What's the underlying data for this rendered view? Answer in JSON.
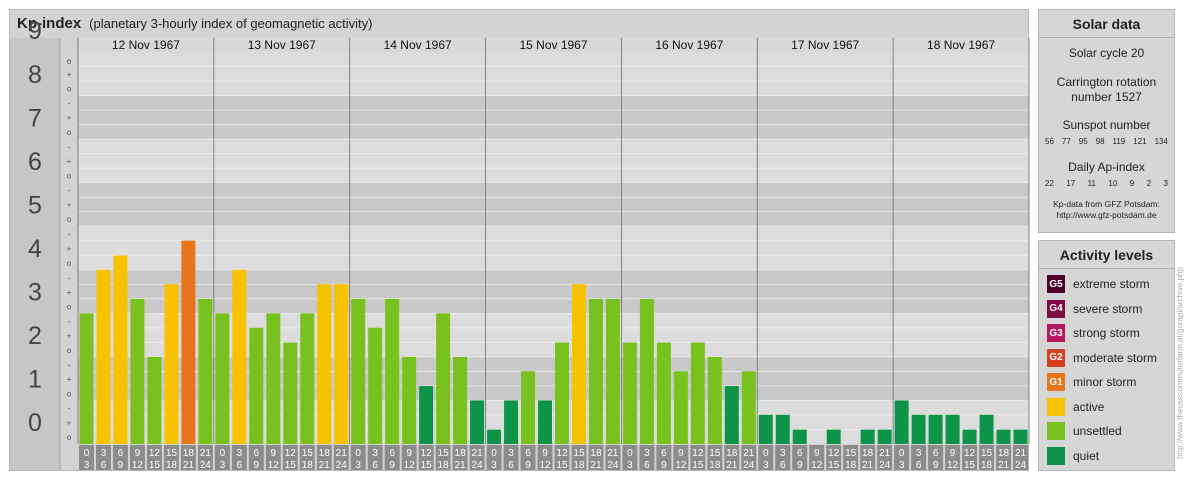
{
  "header": {
    "title": "Kp-index",
    "subtitle": "(planetary 3-hourly index of geomagnetic activity)"
  },
  "colors": {
    "quiet": "#0d9448",
    "unsettled": "#79c11f",
    "active": "#f7c200",
    "g1": "#e8751a",
    "g2": "#d7401e",
    "g3": "#b3175c",
    "g4": "#7e0e42",
    "g5": "#4e0428"
  },
  "chart_data": {
    "type": "bar",
    "y_label_ticks": [
      "0",
      "1",
      "2",
      "3",
      "4",
      "5",
      "6",
      "7",
      "8",
      "9"
    ],
    "y_minor_ticks": [
      "o",
      "+",
      "-"
    ],
    "ylim": [
      0,
      9
    ],
    "days": [
      "12 Nov 1967",
      "13 Nov 1967",
      "14 Nov 1967",
      "15 Nov 1967",
      "16 Nov 1967",
      "17 Nov 1967",
      "18 Nov 1967"
    ],
    "hour_labels": [
      [
        "0",
        "3"
      ],
      [
        "3",
        "6"
      ],
      [
        "6",
        "9"
      ],
      [
        "9",
        "12"
      ],
      [
        "12",
        "15"
      ],
      [
        "15",
        "18"
      ],
      [
        "18",
        "21"
      ],
      [
        "21",
        "24"
      ]
    ],
    "values": [
      [
        3.0,
        4.0,
        4.33,
        3.33,
        2.0,
        3.67,
        4.67,
        3.33
      ],
      [
        3.0,
        4.0,
        2.67,
        3.0,
        2.33,
        3.0,
        3.67,
        3.67
      ],
      [
        3.33,
        2.67,
        3.33,
        2.0,
        1.33,
        3.0,
        2.0,
        1.0
      ],
      [
        0.33,
        1.0,
        1.67,
        1.0,
        2.33,
        3.67,
        3.33,
        3.33
      ],
      [
        2.33,
        3.33,
        2.33,
        1.67,
        2.33,
        2.0,
        1.33,
        1.67
      ],
      [
        0.67,
        0.67,
        0.33,
        0.0,
        0.33,
        0.0,
        0.33,
        0.33
      ],
      [
        1.0,
        0.67,
        0.67,
        0.67,
        0.33,
        0.67,
        0.33,
        0.33
      ]
    ]
  },
  "solar": {
    "title": "Solar data",
    "cycle": "Solar cycle 20",
    "carrington_line1": "Carrington rotation",
    "carrington_line2": "number 1527",
    "sunspot_label": "Sunspot number",
    "sunspots": [
      "56",
      "77",
      "95",
      "98",
      "119",
      "121",
      "134"
    ],
    "ap_label": "Daily Ap-index",
    "ap": [
      "22",
      "17",
      "11",
      "10",
      "9",
      "2",
      "3"
    ],
    "source_line1": "Kp-data from GFZ Potsdam:",
    "source_line2": "http://www.gfz-potsdam.de"
  },
  "activity": {
    "title": "Activity levels",
    "items": [
      {
        "badge": "G5",
        "label": "extreme storm",
        "color": "#4e0428"
      },
      {
        "badge": "G4",
        "label": "severe storm",
        "color": "#7e0e42"
      },
      {
        "badge": "G3",
        "label": "strong storm",
        "color": "#b3175c"
      },
      {
        "badge": "G2",
        "label": "moderate storm",
        "color": "#d7401e"
      },
      {
        "badge": "G1",
        "label": "minor storm",
        "color": "#e8751a"
      },
      {
        "badge": "",
        "label": "active",
        "color": "#f7c200"
      },
      {
        "badge": "",
        "label": "unsettled",
        "color": "#79c11f"
      },
      {
        "badge": "",
        "label": "quiet",
        "color": "#0d9448"
      }
    ]
  },
  "vertical_url": "http://www.theusecommuterfarm.at/gorapi/archive.php"
}
